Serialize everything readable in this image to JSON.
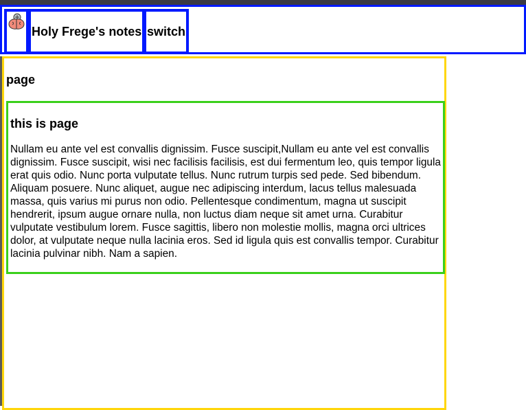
{
  "header": {
    "logo_icon": "brain-icon",
    "title": "Holy Frege's notes",
    "switch_label": "switch"
  },
  "page": {
    "heading": "page",
    "card": {
      "heading": "this is page",
      "body": "Nullam eu ante vel est convallis dignissim. Fusce suscipit,Nullam eu ante vel est convallis dignissim. Fusce suscipit, wisi nec facilisis facilisis, est dui fermentum leo, quis tempor ligula erat quis odio. Nunc porta vulputate tellus. Nunc rutrum turpis sed pede. Sed bibendum. Aliquam posuere. Nunc aliquet, augue nec adipiscing interdum, lacus tellus malesuada massa, quis varius mi purus non odio. Pellentesque condimentum, magna ut suscipit hendrerit, ipsum augue ornare nulla, non luctus diam neque sit amet urna. Curabitur vulputate vestibulum lorem. Fusce sagittis, libero non molestie mollis, magna orci ultrices dolor, at vulputate neque nulla lacinia eros. Sed id ligula quis est convallis tempor. Curabitur lacinia pulvinar nibh. Nam a sapien."
    }
  },
  "colors": {
    "header_border": "#0019ff",
    "page_border": "#ffd60a",
    "card_border": "#3ad01b"
  }
}
